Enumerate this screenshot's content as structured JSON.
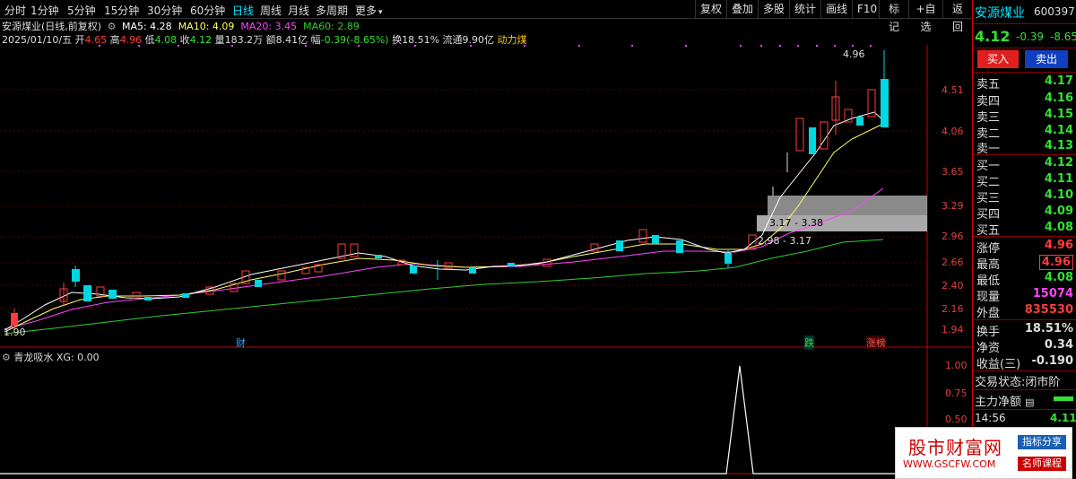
{
  "toolbar": {
    "tabs": [
      "分时",
      "1分钟",
      "5分钟",
      "15分钟",
      "30分钟",
      "60分钟",
      "日线",
      "周线",
      "月线",
      "多周期",
      "更多"
    ],
    "active_tab": "日线",
    "right_buttons": [
      "复权",
      "叠加",
      "多股",
      "统计",
      "画线",
      "F10",
      "标记",
      "+自选",
      "返回"
    ]
  },
  "header": {
    "stock_title": "安源煤业(日线,前复权)",
    "ma5_label": "MA5: 4.28",
    "ma10_label": "MA10: 4.09",
    "ma20_label": "MA20: 3.45",
    "ma60_label": "MA60: 2.89",
    "date": "2025/01/10/五",
    "open_label": "开",
    "open_value": "4.65",
    "high_label": "高",
    "high_value": "4.96",
    "low_label": "低",
    "low_value": "4.08",
    "close_label": "收",
    "close_value": "4.12",
    "vol_label": "量",
    "vol_value": "183.2万",
    "amount_label": "额",
    "amount_value": "8.41亿",
    "change_label": "幅",
    "change_value": "-0.39(-8.65%)",
    "turnover": "换18.51%",
    "float": "流通9.90亿",
    "concept": "动力煤"
  },
  "price_axis": [
    "4.51",
    "4.06",
    "3.65",
    "3.29",
    "2.96",
    "2.66",
    "2.40",
    "2.16",
    "1.94"
  ],
  "indicator_axis": [
    "1.00",
    "0.75",
    "0.50"
  ],
  "annotations": {
    "high_mark": "4.96",
    "low_mark": "1.90",
    "gap1": "3.17 - 3.38",
    "gap2": "2.98 - 3.17",
    "tag_cai": "财",
    "tag_die": "跌",
    "tag_zhangbang": "涨榜"
  },
  "indicator": {
    "name": "青龙吸水",
    "value": "XG: 0.00"
  },
  "panel": {
    "name": "安源煤业",
    "code": "600397",
    "price": "4.12",
    "change": "-0.39",
    "change_pct": "-8.65",
    "buy_btn": "买入",
    "sell_btn": "卖出",
    "asks": [
      {
        "label": "卖五",
        "price": "4.17"
      },
      {
        "label": "卖四",
        "price": "4.16"
      },
      {
        "label": "卖三",
        "price": "4.15"
      },
      {
        "label": "卖二",
        "price": "4.14"
      },
      {
        "label": "卖一",
        "price": "4.13"
      }
    ],
    "bids": [
      {
        "label": "买一",
        "price": "4.12"
      },
      {
        "label": "买二",
        "price": "4.11"
      },
      {
        "label": "买三",
        "price": "4.10"
      },
      {
        "label": "买四",
        "price": "4.09"
      },
      {
        "label": "买五",
        "price": "4.08"
      }
    ],
    "stats": [
      {
        "label": "涨停",
        "value": "4.96",
        "color": "#ff3b3b"
      },
      {
        "label": "最高",
        "value": "4.96",
        "color": "#ff3b3b"
      },
      {
        "label": "最低",
        "value": "4.08",
        "color": "#33e033"
      },
      {
        "label": "现量",
        "value": "15074",
        "color": "#ff44ff"
      },
      {
        "label": "外盘",
        "value": "835530",
        "color": "#ff3b3b"
      }
    ],
    "stats2": [
      {
        "label": "换手",
        "value": "18.51%",
        "color": "#dddddd"
      },
      {
        "label": "净资",
        "value": "0.34",
        "color": "#dddddd"
      },
      {
        "label": "收益(三)",
        "value": "-0.190",
        "color": "#dddddd"
      }
    ],
    "trade_status": "交易状态:闭市阶",
    "main_net": "主力净额",
    "last_time": "14:56",
    "last_price": "4.11"
  },
  "ad": {
    "site_name": "股市财富网",
    "tag1": "指标分享",
    "url": "WWW.GSCFW.COM",
    "tag2": "名师课程"
  },
  "colors": {
    "up": "#ff3b3b",
    "down": "#00d7e0",
    "ma5": "#ffffff",
    "ma10": "#ffff66",
    "ma20": "#ff44ff",
    "ma60": "#33cc33"
  }
}
